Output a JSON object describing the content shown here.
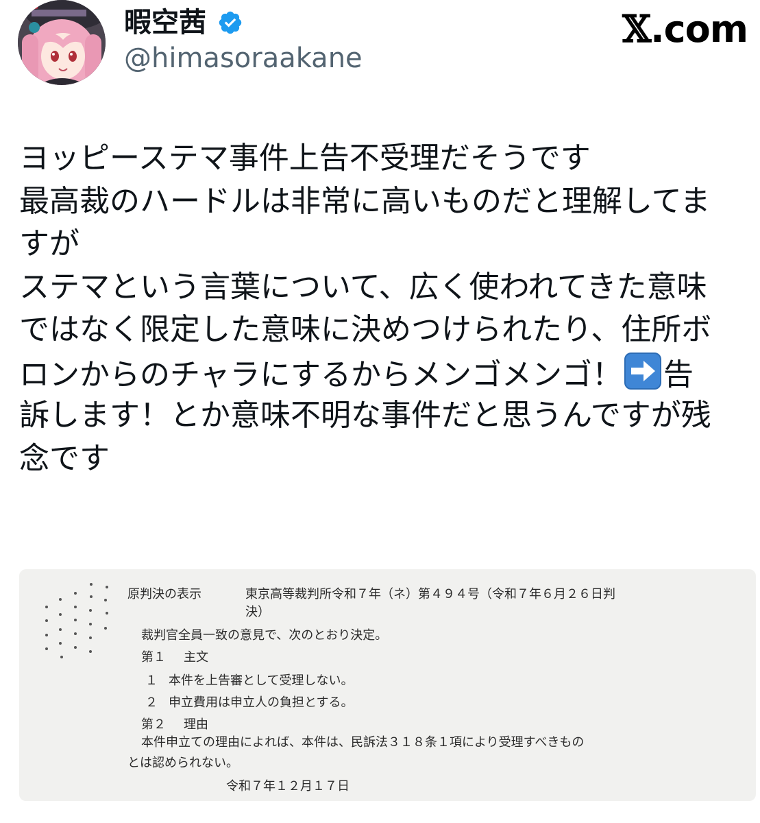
{
  "header": {
    "display_name": "暇空茜",
    "handle": "@himasoraakane",
    "brand_x": "𝕏",
    "brand_text": ".com",
    "verified_icon": "verified-badge-icon",
    "verified_color": "#1d9bf0"
  },
  "tweet": {
    "lines": [
      "ヨッピーステマ事件上告不受理だそうです",
      "最高裁のハードルは非常に高いものだと理解してま",
      "すが",
      "ステマという言葉について、広く使われてきた意味",
      "ではなく限定した意味に決めつけられたり、住所ボ",
      "ロンからのチャラにするからメンゴメンゴ！",
      "告",
      "訴します！とか意味不明な事件だと思うんですが残",
      "念です"
    ],
    "emoji": "right-arrow-emoji"
  },
  "document": {
    "line1_label": "原判決の表示",
    "line1_value": "東京高等裁判所令和７年（ネ）第４９４号（令和７年６月２６日判",
    "line2": "決）",
    "line3": "裁判官全員一致の意見で、次のとおり決定。",
    "line4_num": "第１",
    "line4_text": "主文",
    "line5_num": "１",
    "line5_text": "本件を上告審として受理しない。",
    "line6_num": "２",
    "line6_text": "申立費用は申立人の負担とする。",
    "line7_num": "第２",
    "line7_text": "理由",
    "line8": "本件申立ての理由によれば、本件は、民訴法３１８条１項により受理すべきもの",
    "line9": "とは認められない。",
    "line10": "令和７年１２月１７日"
  }
}
